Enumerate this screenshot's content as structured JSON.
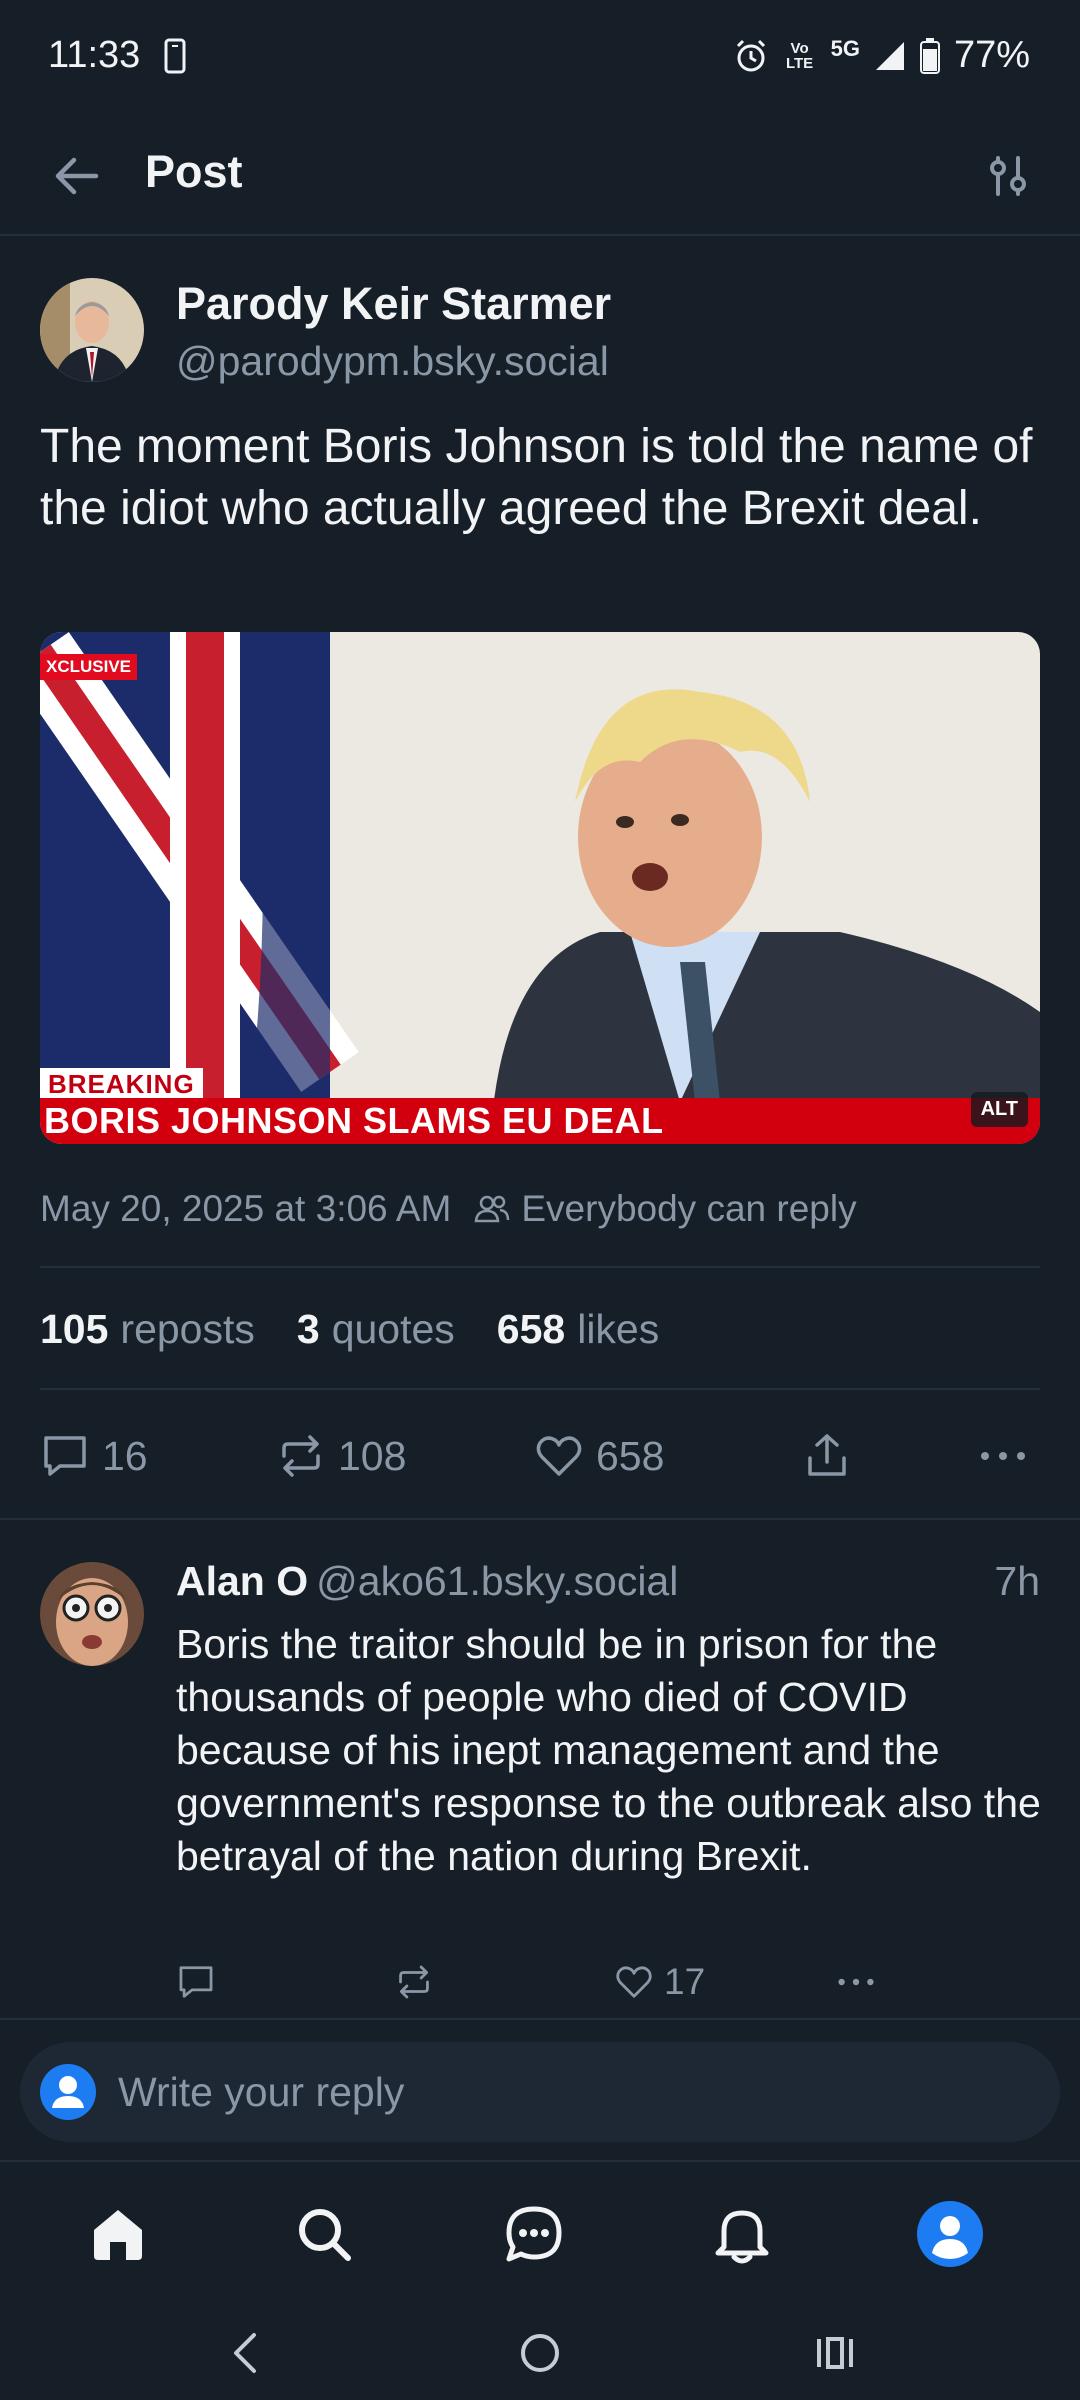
{
  "status_bar": {
    "time": "11:33",
    "network_volte": "Vo LTE",
    "network_5g": "5G",
    "battery": "77%"
  },
  "header": {
    "title": "Post",
    "back_icon": "arrow-left-icon",
    "filter_icon": "sliders-icon"
  },
  "post": {
    "author_name": "Parody Keir Starmer",
    "author_handle": "@parodypm.bsky.social",
    "text": "The moment Boris Johnson is told the name of the idiot who actually agreed the Brexit deal.",
    "image": {
      "exclusive_label": "XCLUSIVE",
      "breaking_label": "BREAKING",
      "headline": "BORIS JOHNSON SLAMS EU DEAL",
      "alt_badge": "ALT"
    },
    "timestamp": "May 20, 2025 at 3:06 AM",
    "reply_setting": "Everybody can reply",
    "stats": {
      "reposts_count": "105",
      "reposts_label": "reposts",
      "quotes_count": "3",
      "quotes_label": "quotes",
      "likes_count": "658",
      "likes_label": "likes"
    },
    "actions": {
      "replies": "16",
      "reposts": "108",
      "likes": "658"
    }
  },
  "reply": {
    "author_name": "Alan O",
    "author_handle": "@ako61.bsky.social",
    "time": "7h",
    "text": "Boris the traitor should be in prison for the thousands of people who died of COVID because of his inept management and the government's response to the outbreak also the betrayal of the nation during Brexit.",
    "likes": "17"
  },
  "composer": {
    "placeholder": "Write your reply"
  },
  "bottom_nav": [
    "home-icon",
    "search-icon",
    "chat-icon",
    "bell-icon",
    "profile-icon"
  ],
  "colors": {
    "background": "#161e27",
    "accent": "#1d7cf2",
    "muted_text": "#8a97a6",
    "news_red": "#d2000f"
  }
}
